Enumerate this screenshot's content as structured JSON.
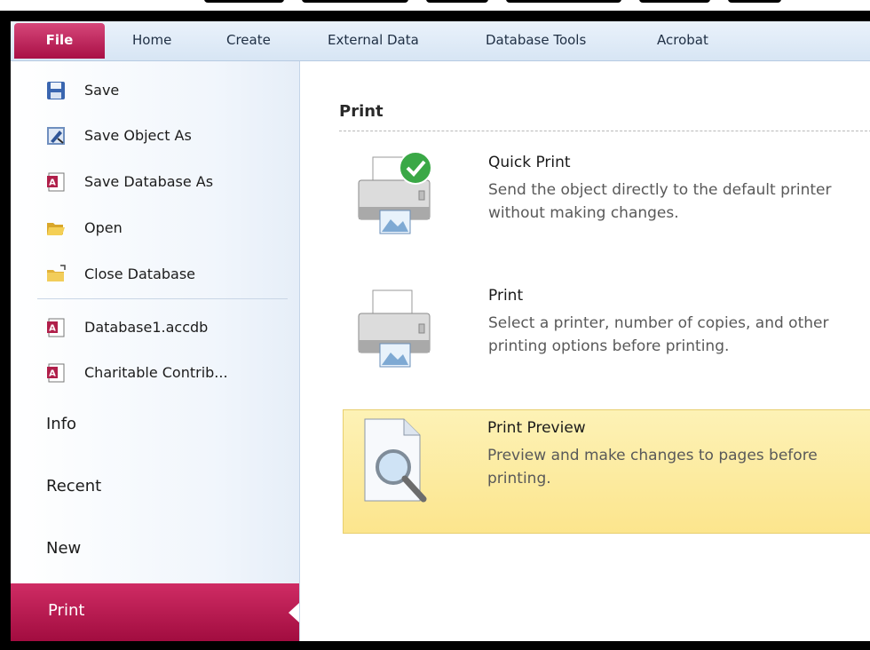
{
  "ribbon": {
    "tabs": [
      "File",
      "Home",
      "Create",
      "External Data",
      "Database Tools",
      "Acrobat"
    ]
  },
  "backstage": {
    "commands": [
      {
        "label": "Save",
        "icon": "save-icon"
      },
      {
        "label": "Save Object As",
        "icon": "save-object-as-icon"
      },
      {
        "label": "Save Database As",
        "icon": "access-database-icon"
      },
      {
        "label": "Open",
        "icon": "open-folder-icon"
      },
      {
        "label": "Close Database",
        "icon": "close-database-folder-icon"
      }
    ],
    "recent_files": [
      {
        "label": "Database1.accdb",
        "icon": "access-database-icon"
      },
      {
        "label": "Charitable Contrib...",
        "icon": "access-database-icon"
      }
    ],
    "nav": [
      "Info",
      "Recent",
      "New",
      "Print"
    ],
    "active_nav": "Print"
  },
  "print_pane": {
    "title": "Print",
    "options": [
      {
        "title": "Quick Print",
        "desc": "Send the object directly to the default printer without making changes.",
        "icon": "quick-print-icon"
      },
      {
        "title": "Print",
        "desc": "Select a printer, number of copies, and other printing options before printing.",
        "icon": "printer-icon"
      },
      {
        "title": "Print Preview",
        "desc": "Preview and make changes to pages before printing.",
        "icon": "print-preview-icon"
      }
    ]
  },
  "colors": {
    "file_tab": "#c0205a",
    "active_nav": "#b8184f",
    "highlight": "#fce58d"
  }
}
